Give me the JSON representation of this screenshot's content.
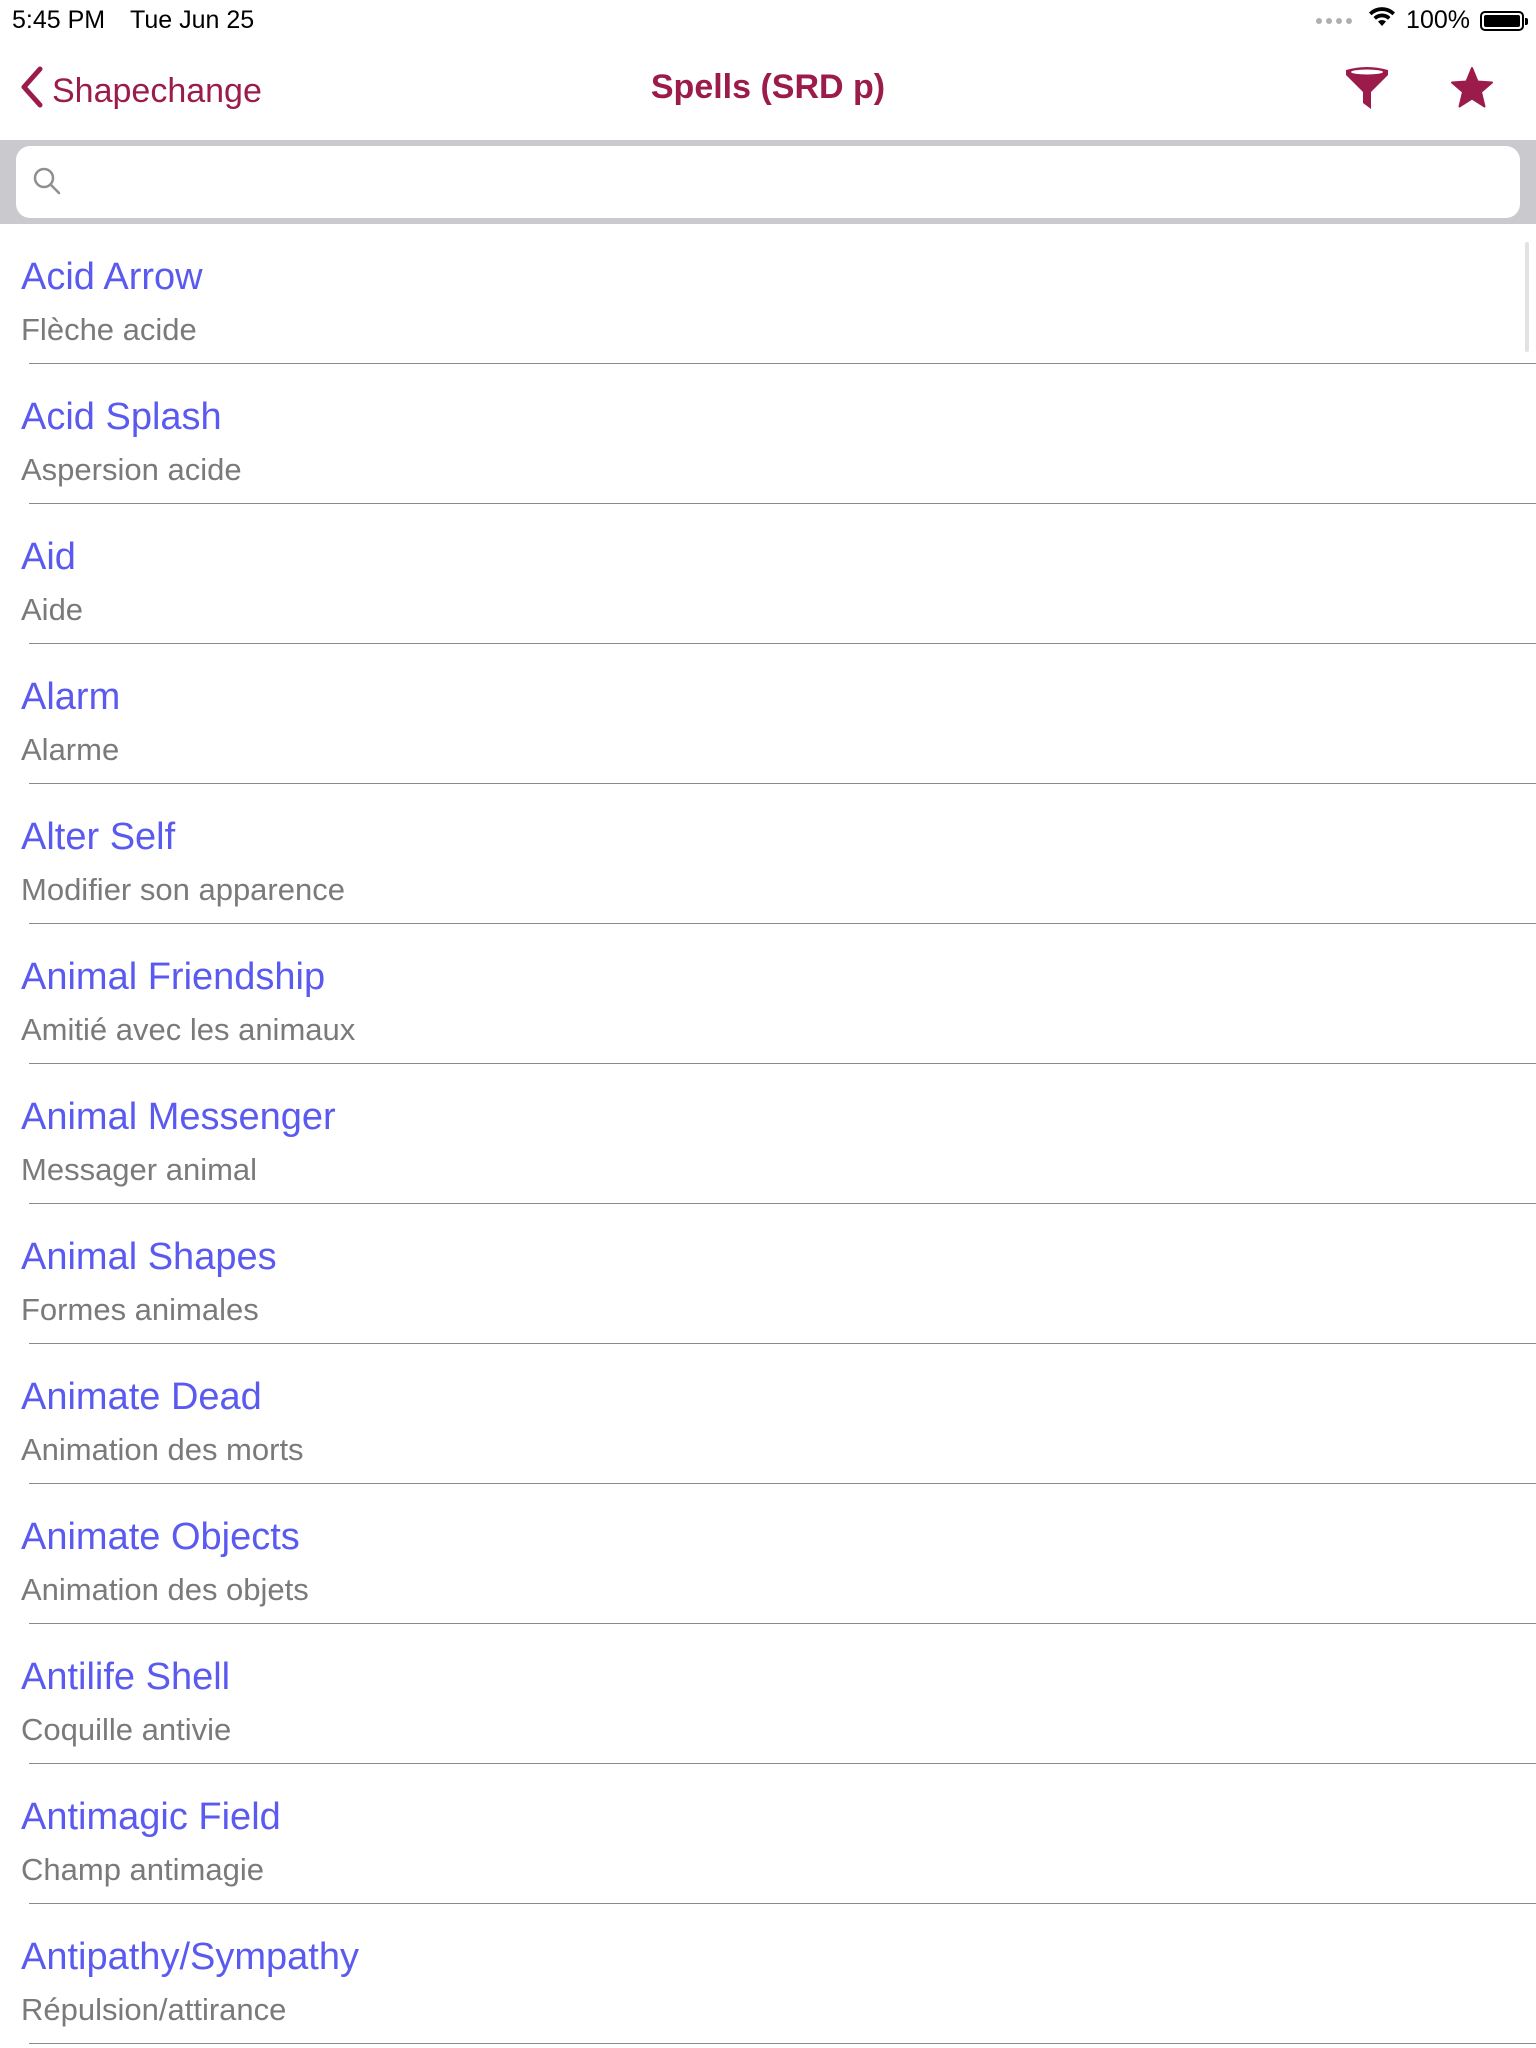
{
  "status_bar": {
    "time": "5:45 PM",
    "date": "Tue Jun 25",
    "battery": "100%"
  },
  "nav": {
    "back_label": "Shapechange",
    "title": "Spells (SRD p)"
  },
  "search": {
    "value": "",
    "placeholder": ""
  },
  "colors": {
    "accent": "#9b1b4b",
    "link": "#5a5af0",
    "subtitle": "#7a7a7a"
  },
  "icons": [
    "chevron-left-icon",
    "filter-icon",
    "star-icon",
    "search-icon",
    "wifi-icon",
    "battery-icon"
  ],
  "spells": [
    {
      "name": "Acid Arrow",
      "translation": "Flèche acide"
    },
    {
      "name": "Acid Splash",
      "translation": "Aspersion acide"
    },
    {
      "name": "Aid",
      "translation": "Aide"
    },
    {
      "name": "Alarm",
      "translation": "Alarme"
    },
    {
      "name": "Alter Self",
      "translation": "Modifier son apparence"
    },
    {
      "name": "Animal Friendship",
      "translation": "Amitié avec les animaux"
    },
    {
      "name": "Animal Messenger",
      "translation": "Messager animal"
    },
    {
      "name": "Animal Shapes",
      "translation": "Formes animales"
    },
    {
      "name": "Animate Dead",
      "translation": "Animation des morts"
    },
    {
      "name": "Animate Objects",
      "translation": "Animation des objets"
    },
    {
      "name": "Antilife Shell",
      "translation": "Coquille antivie"
    },
    {
      "name": "Antimagic Field",
      "translation": "Champ antimagie"
    },
    {
      "name": "Antipathy/Sympathy",
      "translation": "Répulsion/attirance"
    }
  ]
}
